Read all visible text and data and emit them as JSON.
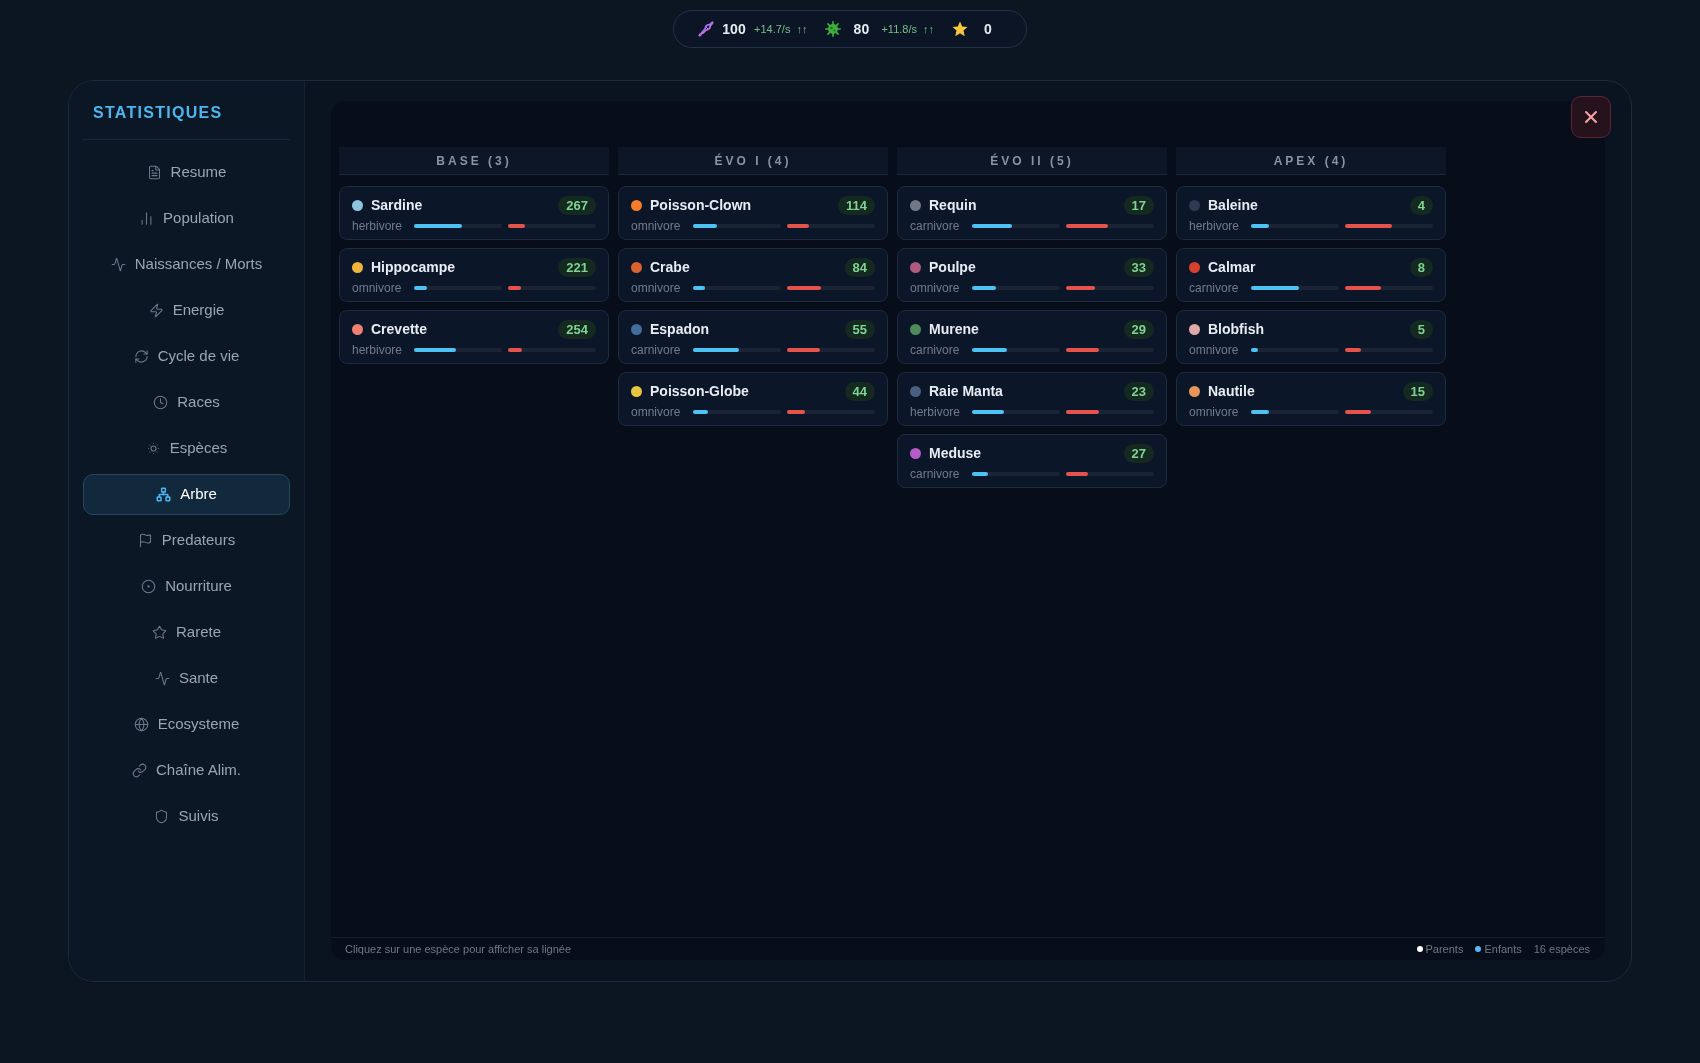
{
  "resources": [
    {
      "value": "100",
      "rate": "+14.7/s",
      "trend": "↑↑"
    },
    {
      "value": "80",
      "rate": "+11.8/s",
      "trend": "↑↑"
    },
    {
      "value": "0"
    }
  ],
  "sidebar": {
    "title": "STATISTIQUES",
    "items": [
      {
        "label": "Resume",
        "selected": false
      },
      {
        "label": "Population",
        "selected": false
      },
      {
        "label": "Naissances / Morts",
        "selected": false
      },
      {
        "label": "Energie",
        "selected": false
      },
      {
        "label": "Cycle de vie",
        "selected": false
      },
      {
        "label": "Races",
        "selected": false
      },
      {
        "label": "Espèces",
        "selected": false
      },
      {
        "label": "Arbre",
        "selected": true
      },
      {
        "label": "Predateurs",
        "selected": false
      },
      {
        "label": "Nourriture",
        "selected": false
      },
      {
        "label": "Rarete",
        "selected": false
      },
      {
        "label": "Sante",
        "selected": false
      },
      {
        "label": "Ecosysteme",
        "selected": false
      },
      {
        "label": "Chaîne Alim.",
        "selected": false
      },
      {
        "label": "Suivis",
        "selected": false
      }
    ]
  },
  "columns": [
    {
      "title": "BASE (3)",
      "species": [
        {
          "name": "Sardine",
          "color": "#8ec5dc",
          "count": "267",
          "diet": "herbivore",
          "meters": [
            {
              "color": "#4cc2f5",
              "level": 0.55
            },
            {
              "color": "#e5534b",
              "level": 0.19
            }
          ]
        },
        {
          "name": "Hippocampe",
          "color": "#f0b43c",
          "count": "221",
          "diet": "omnivore",
          "meters": [
            {
              "color": "#4cc2f5",
              "level": 0.15
            },
            {
              "color": "#e5534b",
              "level": 0.15
            }
          ]
        },
        {
          "name": "Crevette",
          "color": "#f08070",
          "count": "254",
          "diet": "herbivore",
          "meters": [
            {
              "color": "#4cc2f5",
              "level": 0.48
            },
            {
              "color": "#e5534b",
              "level": 0.16
            }
          ]
        }
      ]
    },
    {
      "title": "ÉVO I (4)",
      "species": [
        {
          "name": "Poisson-Clown",
          "color": "#f57c28",
          "count": "114",
          "diet": "omnivore",
          "meters": [
            {
              "color": "#4cc2f5",
              "level": 0.27
            },
            {
              "color": "#e5534b",
              "level": 0.25
            }
          ]
        },
        {
          "name": "Crabe",
          "color": "#d9622e",
          "count": "84",
          "diet": "omnivore",
          "meters": [
            {
              "color": "#4cc2f5",
              "level": 0.14
            },
            {
              "color": "#e5534b",
              "level": 0.39
            }
          ]
        },
        {
          "name": "Espadon",
          "color": "#3f6f9a",
          "count": "55",
          "diet": "carnivore",
          "meters": [
            {
              "color": "#4cc2f5",
              "level": 0.52
            },
            {
              "color": "#e5534b",
              "level": 0.37
            }
          ]
        },
        {
          "name": "Poisson-Globe",
          "color": "#e8c440",
          "count": "44",
          "diet": "omnivore",
          "meters": [
            {
              "color": "#4cc2f5",
              "level": 0.17
            },
            {
              "color": "#e5534b",
              "level": 0.21
            }
          ]
        }
      ]
    },
    {
      "title": "ÉVO II (5)",
      "species": [
        {
          "name": "Requin",
          "color": "#6f7884",
          "count": "17",
          "diet": "carnivore",
          "meters": [
            {
              "color": "#4cc2f5",
              "level": 0.46
            },
            {
              "color": "#e5534b",
              "level": 0.48
            }
          ]
        },
        {
          "name": "Poulpe",
          "color": "#b05a7e",
          "count": "33",
          "diet": "omnivore",
          "meters": [
            {
              "color": "#4cc2f5",
              "level": 0.27
            },
            {
              "color": "#e5534b",
              "level": 0.33
            }
          ]
        },
        {
          "name": "Murene",
          "color": "#4f8a5a",
          "count": "29",
          "diet": "carnivore",
          "meters": [
            {
              "color": "#4cc2f5",
              "level": 0.4
            },
            {
              "color": "#e5534b",
              "level": 0.37
            }
          ]
        },
        {
          "name": "Raie Manta",
          "color": "#4a5f80",
          "count": "23",
          "diet": "herbivore",
          "meters": [
            {
              "color": "#4cc2f5",
              "level": 0.36
            },
            {
              "color": "#e5534b",
              "level": 0.38
            }
          ]
        },
        {
          "name": "Meduse",
          "color": "#b45cc8",
          "count": "27",
          "diet": "carnivore",
          "meters": [
            {
              "color": "#4cc2f5",
              "level": 0.18
            },
            {
              "color": "#e5534b",
              "level": 0.25
            }
          ]
        }
      ]
    },
    {
      "title": "APEX (4)",
      "species": [
        {
          "name": "Baleine",
          "color": "#2e3a52",
          "count": "4",
          "diet": "herbivore",
          "meters": [
            {
              "color": "#4cc2f5",
              "level": 0.21
            },
            {
              "color": "#e5534b",
              "level": 0.53
            }
          ]
        },
        {
          "name": "Calmar",
          "color": "#d8402e",
          "count": "8",
          "diet": "carnivore",
          "meters": [
            {
              "color": "#4cc2f5",
              "level": 0.54
            },
            {
              "color": "#e5534b",
              "level": 0.41
            }
          ]
        },
        {
          "name": "Blobfish",
          "color": "#e0a8a8",
          "count": "5",
          "diet": "omnivore",
          "meters": [
            {
              "color": "#4cc2f5",
              "level": 0.08
            },
            {
              "color": "#e5534b",
              "level": 0.18
            }
          ]
        },
        {
          "name": "Nautile",
          "color": "#e8955a",
          "count": "15",
          "diet": "omnivore",
          "meters": [
            {
              "color": "#4cc2f5",
              "level": 0.2
            },
            {
              "color": "#e5534b",
              "level": 0.3
            }
          ]
        }
      ]
    }
  ],
  "footer": {
    "hint": "Cliquez sur une espèce pour afficher sa lignée",
    "legend": [
      {
        "label": "Parents",
        "color": "#ffffff"
      },
      {
        "label": "Enfants",
        "color": "#5bb8f0"
      }
    ],
    "total": "16 espèces"
  }
}
